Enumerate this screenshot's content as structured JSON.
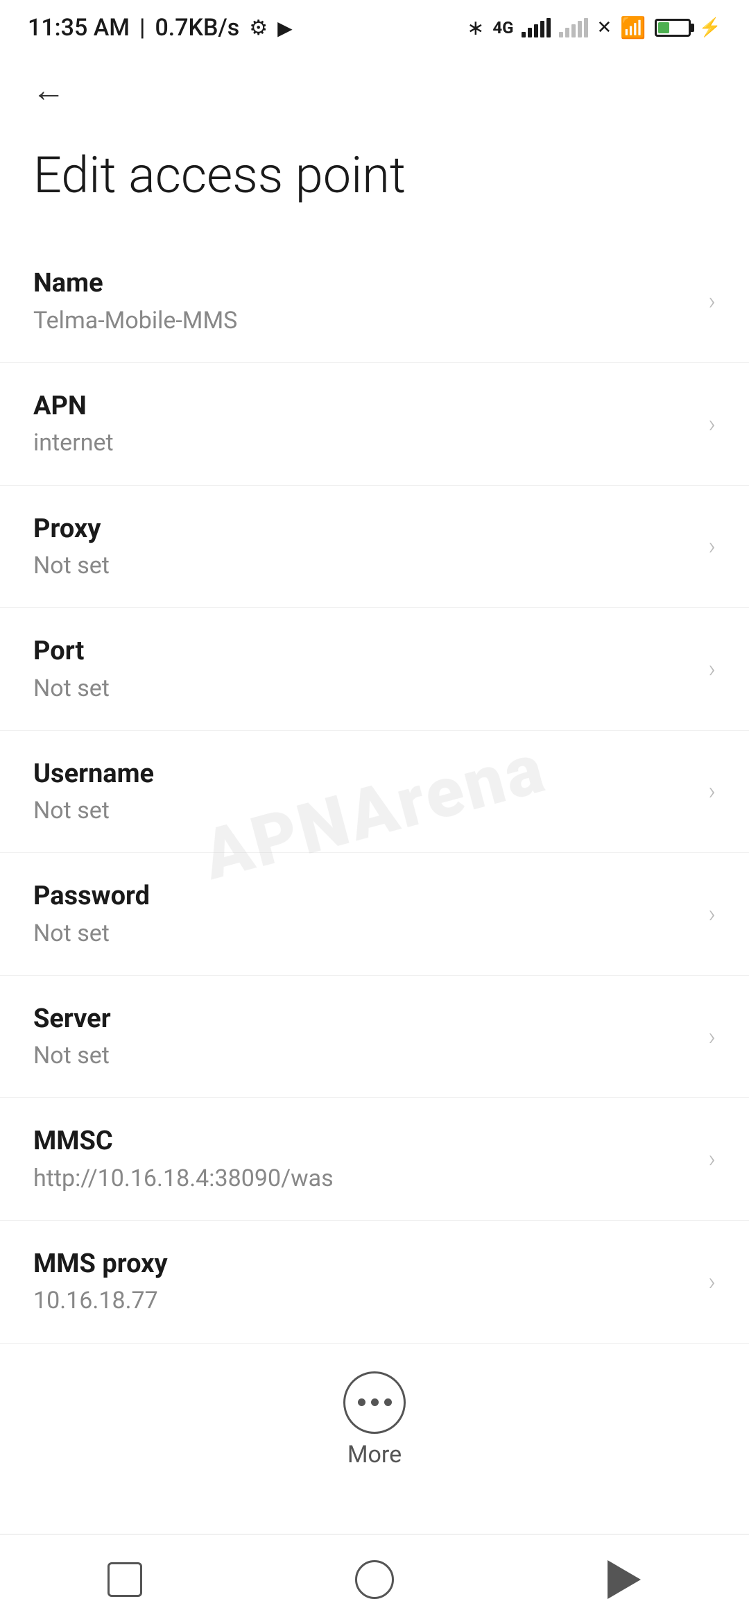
{
  "statusBar": {
    "time": "11:35 AM",
    "speed": "0.7KB/s"
  },
  "toolbar": {
    "backLabel": "←"
  },
  "page": {
    "title": "Edit access point"
  },
  "settings": {
    "items": [
      {
        "label": "Name",
        "value": "Telma-Mobile-MMS"
      },
      {
        "label": "APN",
        "value": "internet"
      },
      {
        "label": "Proxy",
        "value": "Not set"
      },
      {
        "label": "Port",
        "value": "Not set"
      },
      {
        "label": "Username",
        "value": "Not set"
      },
      {
        "label": "Password",
        "value": "Not set"
      },
      {
        "label": "Server",
        "value": "Not set"
      },
      {
        "label": "MMSC",
        "value": "http://10.16.18.4:38090/was"
      },
      {
        "label": "MMS proxy",
        "value": "10.16.18.77"
      }
    ]
  },
  "more": {
    "label": "More"
  },
  "watermark": {
    "text": "APNArena"
  },
  "navigation": {
    "square": "",
    "circle": "",
    "triangle": ""
  }
}
